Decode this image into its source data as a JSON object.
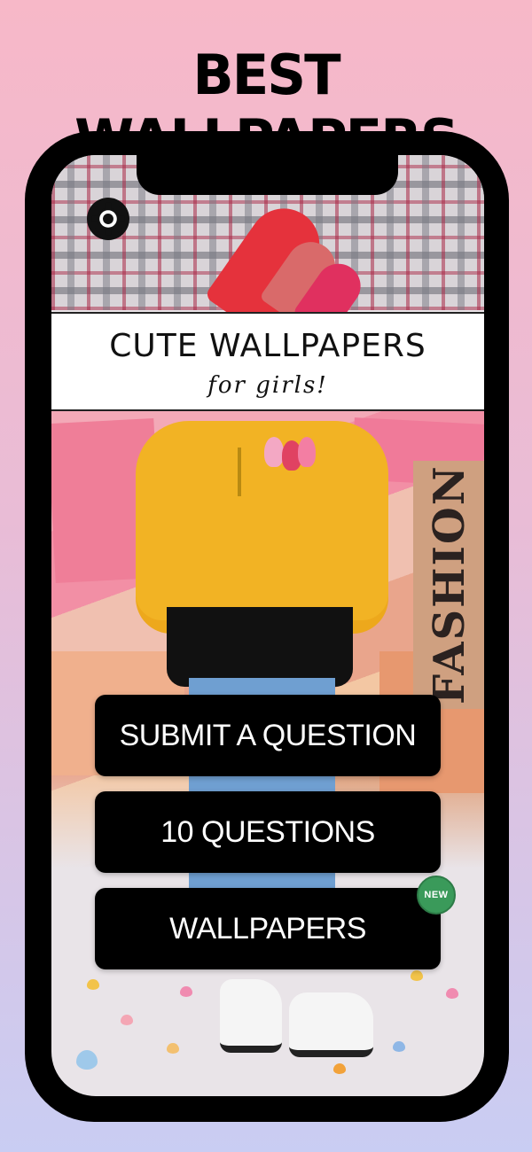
{
  "headline": "BEST WALLPAPERS",
  "app": {
    "title": "CUTE WALLPAPERS",
    "subtitle": "for girls!",
    "settings_icon": "gear-icon",
    "poster_text": "FASHION"
  },
  "buttons": [
    {
      "label": "SUBMIT A QUESTION"
    },
    {
      "label": "10 QUESTIONS"
    },
    {
      "label": "WALLPAPERS",
      "badge": "NEW"
    }
  ],
  "colors": {
    "button_bg": "#000000",
    "badge_bg": "#3a9a5a"
  }
}
